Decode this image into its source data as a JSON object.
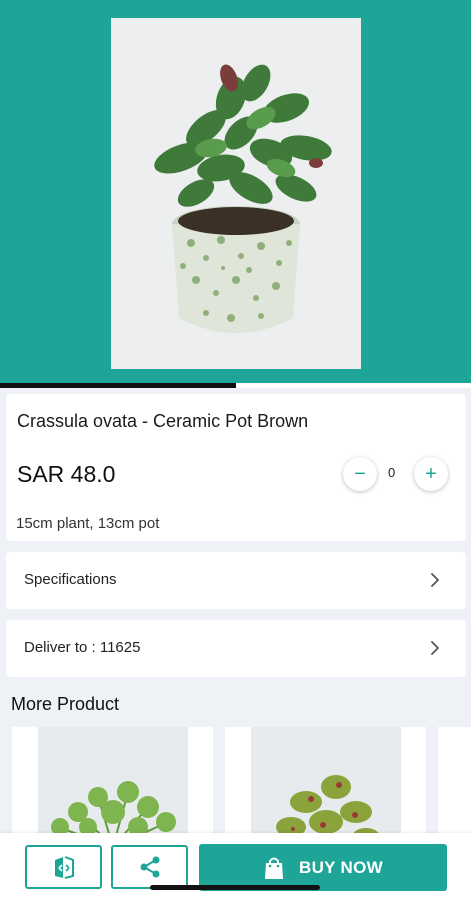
{
  "product": {
    "title": "Crassula ovata - Ceramic Pot Brown",
    "price": "SAR 48.0",
    "size_note": "15cm plant, 13cm pot",
    "image_progress": 0.5
  },
  "quantity": {
    "value": "0",
    "minus_label": "−",
    "plus_label": "+"
  },
  "rows": {
    "specifications_label": "Specifications",
    "deliver_label": "Deliver to : 11625"
  },
  "more": {
    "title": "More Product"
  },
  "actions": {
    "buy_label": "BUY NOW"
  },
  "colors": {
    "accent": "#1ea597",
    "background": "#eef1f6"
  },
  "icons": {
    "compare": "compare-icon",
    "share": "share-icon",
    "bag": "shopping-bag-icon",
    "chevron": "chevron-right-icon"
  }
}
